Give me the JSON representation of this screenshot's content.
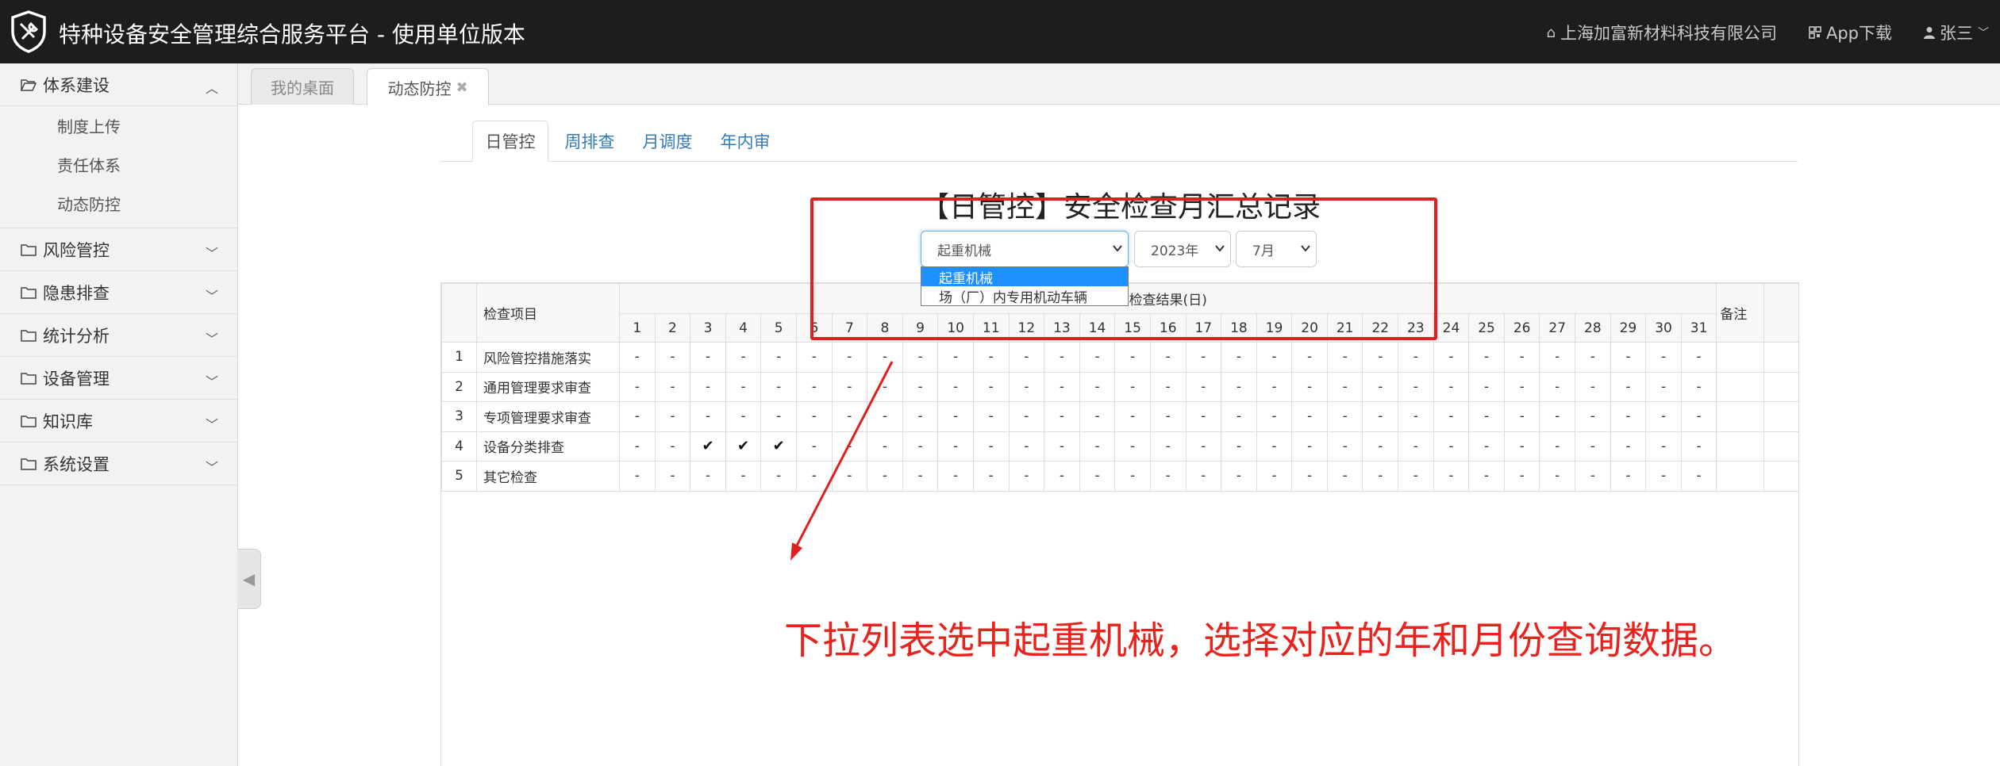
{
  "header": {
    "title": "特种设备安全管理综合服务平台 - 使用单位版本",
    "company": "上海加富新材料科技有限公司",
    "app_download": "App下载",
    "user": "张三",
    "icons": [
      "shield-tools-logo",
      "home-icon",
      "qrcode-icon",
      "user-icon",
      "chevron-down-icon"
    ],
    "bg_color": "#1d1d1d"
  },
  "sidebar": {
    "items": [
      {
        "label": "体系建设",
        "expanded": true,
        "children": [
          "制度上传",
          "责任体系",
          "动态防控"
        ]
      },
      {
        "label": "风险管控",
        "expanded": false
      },
      {
        "label": "隐患排查",
        "expanded": false
      },
      {
        "label": "统计分析",
        "expanded": false
      },
      {
        "label": "设备管理",
        "expanded": false
      },
      {
        "label": "知识库",
        "expanded": false
      },
      {
        "label": "系统设置",
        "expanded": false
      }
    ]
  },
  "page_tabs": [
    {
      "label": "我的桌面",
      "active": false
    },
    {
      "label": "动态防控",
      "active": true,
      "closable": true,
      "close_glyph": "✖"
    }
  ],
  "inner_tabs": [
    {
      "label": "日管控",
      "active": true
    },
    {
      "label": "周排查",
      "active": false
    },
    {
      "label": "月调度",
      "active": false
    },
    {
      "label": "年内审",
      "active": false
    }
  ],
  "report": {
    "title": "【日管控】安全检查月汇总记录"
  },
  "filters": {
    "category": {
      "value": "起重机械",
      "options": [
        "起重机械",
        "场（厂）内专用机动车辆"
      ],
      "highlighted_option": "起重机械"
    },
    "year": {
      "value": "2023年"
    },
    "month": {
      "value": "7月"
    }
  },
  "table": {
    "header_item": "检查项目",
    "header_result": "检查结果(日)",
    "header_note": "备注",
    "days": [
      "1",
      "2",
      "3",
      "4",
      "5",
      "6",
      "7",
      "8",
      "9",
      "10",
      "11",
      "12",
      "13",
      "14",
      "15",
      "16",
      "17",
      "18",
      "19",
      "20",
      "21",
      "22",
      "23",
      "24",
      "25",
      "26",
      "27",
      "28",
      "29",
      "30",
      "31"
    ],
    "rows": [
      {
        "idx": "1",
        "name": "风险管控措施落实",
        "values": [
          "-",
          "-",
          "-",
          "-",
          "-",
          "-",
          "-",
          "-",
          "-",
          "-",
          "-",
          "-",
          "-",
          "-",
          "-",
          "-",
          "-",
          "-",
          "-",
          "-",
          "-",
          "-",
          "-",
          "-",
          "-",
          "-",
          "-",
          "-",
          "-",
          "-",
          "-"
        ]
      },
      {
        "idx": "2",
        "name": "通用管理要求审查",
        "values": [
          "-",
          "-",
          "-",
          "-",
          "-",
          "-",
          "-",
          "-",
          "-",
          "-",
          "-",
          "-",
          "-",
          "-",
          "-",
          "-",
          "-",
          "-",
          "-",
          "-",
          "-",
          "-",
          "-",
          "-",
          "-",
          "-",
          "-",
          "-",
          "-",
          "-",
          "-"
        ]
      },
      {
        "idx": "3",
        "name": "专项管理要求审查",
        "values": [
          "-",
          "-",
          "-",
          "-",
          "-",
          "-",
          "-",
          "-",
          "-",
          "-",
          "-",
          "-",
          "-",
          "-",
          "-",
          "-",
          "-",
          "-",
          "-",
          "-",
          "-",
          "-",
          "-",
          "-",
          "-",
          "-",
          "-",
          "-",
          "-",
          "-",
          "-"
        ]
      },
      {
        "idx": "4",
        "name": "设备分类排查",
        "values": [
          "-",
          "-",
          "✔",
          "✔",
          "✔",
          "-",
          "-",
          "-",
          "-",
          "-",
          "-",
          "-",
          "-",
          "-",
          "-",
          "-",
          "-",
          "-",
          "-",
          "-",
          "-",
          "-",
          "-",
          "-",
          "-",
          "-",
          "-",
          "-",
          "-",
          "-",
          "-"
        ]
      },
      {
        "idx": "5",
        "name": "其它检查",
        "values": [
          "-",
          "-",
          "-",
          "-",
          "-",
          "-",
          "-",
          "-",
          "-",
          "-",
          "-",
          "-",
          "-",
          "-",
          "-",
          "-",
          "-",
          "-",
          "-",
          "-",
          "-",
          "-",
          "-",
          "-",
          "-",
          "-",
          "-",
          "-",
          "-",
          "-",
          "-"
        ]
      }
    ]
  },
  "annotation": {
    "text": "下拉列表选中起重机械，选择对应的年和月份查询数据。",
    "color": "#e21f1f"
  }
}
